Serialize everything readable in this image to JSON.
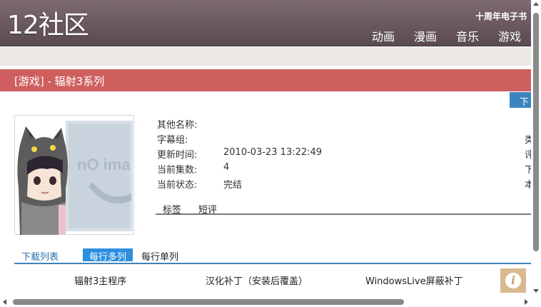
{
  "header": {
    "logo": "12社区",
    "tagline": "十周年电子书",
    "nav": [
      "动画",
      "漫画",
      "音乐",
      "游戏"
    ]
  },
  "title": "[游戏] - 辐射3系列",
  "download_tab_label": "下",
  "cover": {
    "placeholder_text": "nO ima"
  },
  "info": [
    {
      "label": "其他名称:",
      "value": ""
    },
    {
      "label": "字幕组:",
      "value": ""
    },
    {
      "label": "更新时间:",
      "value": "2010-03-23 13:22:49"
    },
    {
      "label": "当前集数:",
      "value": "4"
    },
    {
      "label": "当前状态:",
      "value": "完结"
    }
  ],
  "right_column_cut": [
    "类",
    "评",
    "下",
    "本"
  ],
  "subtabs": [
    "标签",
    "短评"
  ],
  "download": {
    "heading": "下载列表",
    "tab_multi": "每行多列",
    "tab_single": "每行单列",
    "files": [
      "辐射3主程序",
      "汉化补丁（安装后覆盖）",
      "WindowsLive屏蔽补丁"
    ]
  },
  "info_button_glyph": "i",
  "colors": {
    "header": "#6b5860",
    "title_bar": "#cf5f5f",
    "accent_blue": "#2d8ee0",
    "info_button": "#d9b98f"
  }
}
